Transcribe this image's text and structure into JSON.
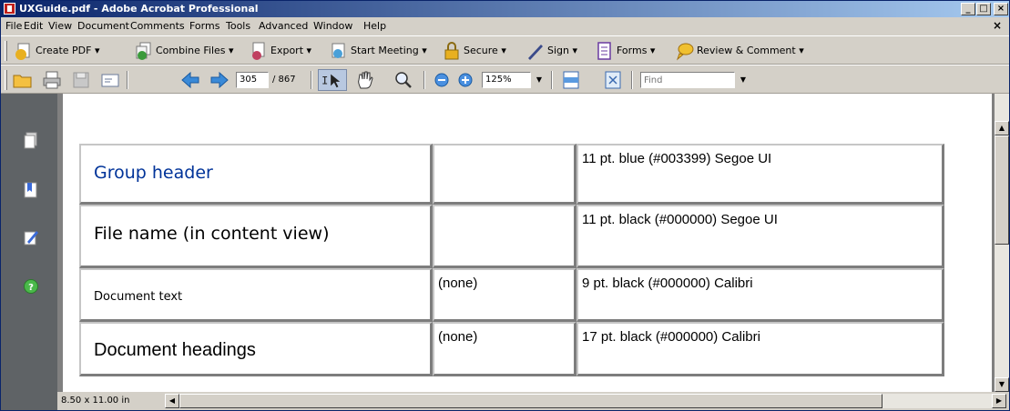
{
  "window": {
    "title": "UXGuide.pdf - Adobe Acrobat Professional",
    "minimize": "_",
    "maximize": "□",
    "close": "×"
  },
  "menu": {
    "items": [
      "File",
      "Edit",
      "View",
      "Document",
      "Comments",
      "Forms",
      "Tools",
      "Advanced",
      "Window",
      "Help"
    ],
    "doc_close": "×"
  },
  "tasks_toolbar": {
    "create_pdf": "Create PDF ▾",
    "combine_files": "Combine Files ▾",
    "export": "Export ▾",
    "start_meeting": "Start Meeting ▾",
    "secure": "Secure ▾",
    "sign": "Sign ▾",
    "forms": "Forms ▾",
    "review_comment": "Review & Comment ▾"
  },
  "nav_toolbar": {
    "page_current": "305",
    "page_total": "/ 867",
    "zoom": "125%",
    "find_placeholder": "Find"
  },
  "document": {
    "rows": [
      {
        "element": "Group header",
        "cell2": "",
        "spec": "11 pt. blue (#003399) Segoe UI"
      },
      {
        "element": "File name (in content view)",
        "cell2": "",
        "spec": "11 pt. black (#000000) Segoe UI"
      },
      {
        "element": "Document text",
        "cell2": "(none)",
        "spec": "9 pt. black (#000000) Calibri"
      },
      {
        "element": "Document headings",
        "cell2": "(none)",
        "spec": "17 pt. black (#000000) Calibri"
      }
    ]
  },
  "status": {
    "page_size": "8.50 x 11.00 in"
  },
  "colors": {
    "title_bar": "#0a246a",
    "nav_pane": "#5f6366",
    "group_header_blue": "#003399"
  }
}
